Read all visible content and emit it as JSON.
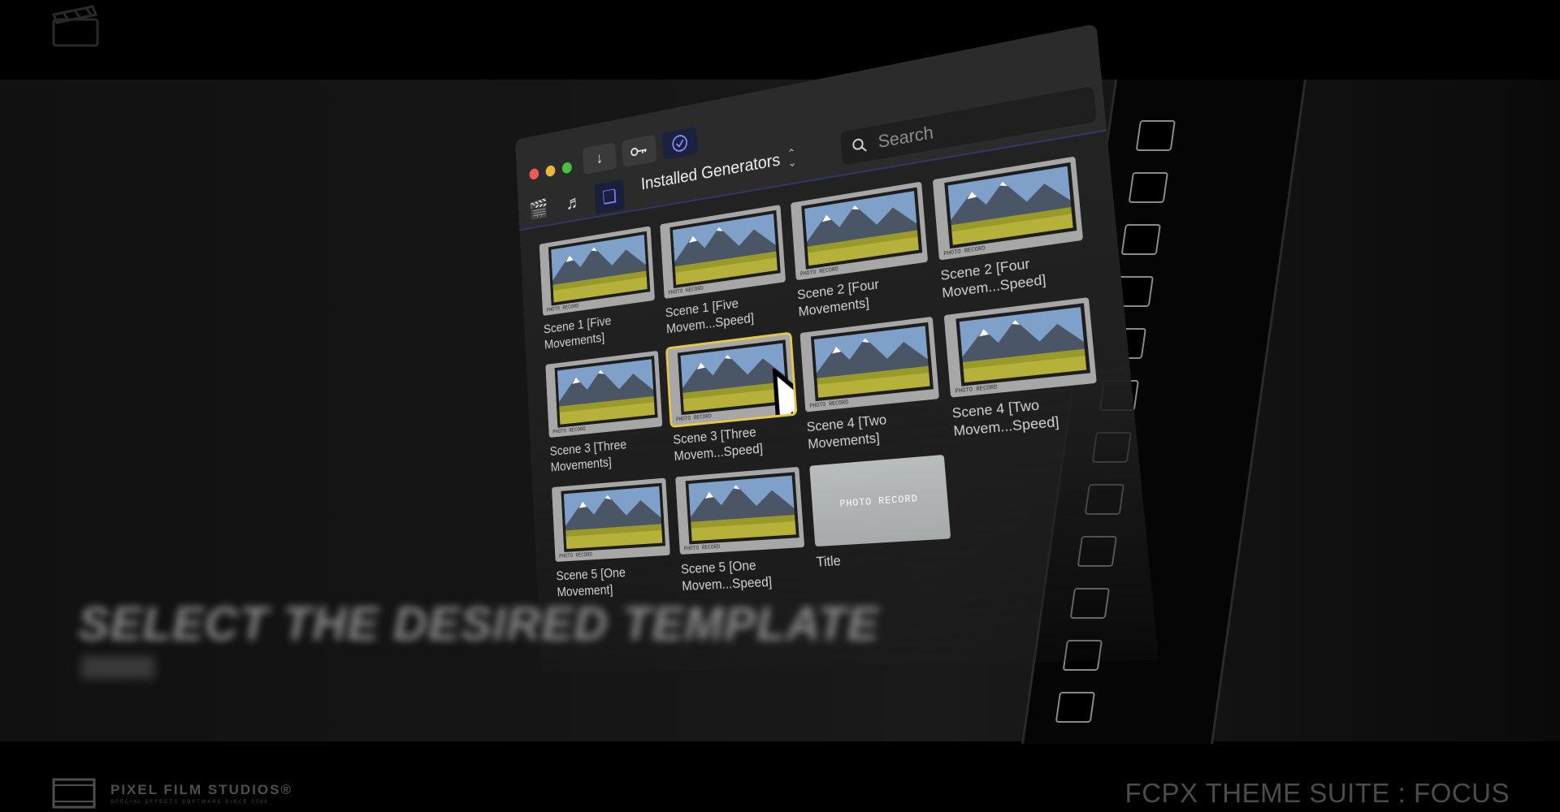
{
  "toolbar": {
    "download_icon": "down-arrow-icon",
    "key_icon": "key-icon",
    "check_icon": "checkmark-circle-icon"
  },
  "tabs": {
    "items": [
      {
        "icon": "clapperboard-star-icon"
      },
      {
        "icon": "camera-music-icon"
      },
      {
        "icon": "generator-icon",
        "active": true
      }
    ]
  },
  "library": {
    "dropdown_label": "Installed Generators"
  },
  "search": {
    "placeholder": "Search",
    "value": ""
  },
  "generators": [
    {
      "label": "Scene 1 [Five Movements]",
      "selected": false
    },
    {
      "label": "Scene 1 [Five Movem...Speed]",
      "selected": false
    },
    {
      "label": "Scene 2 [Four Movements]",
      "selected": false
    },
    {
      "label": "Scene 2 [Four Movem...Speed]",
      "selected": false
    },
    {
      "label": "Scene 3 [Three Movements]",
      "selected": false
    },
    {
      "label": "Scene 3 [Three Movem...Speed]",
      "selected": true
    },
    {
      "label": "Scene 4 [Two Movements]",
      "selected": false
    },
    {
      "label": "Scene 4 [Two Movem...Speed]",
      "selected": false
    },
    {
      "label": "Scene 5 [One Movement]",
      "selected": false
    },
    {
      "label": "Scene 5 [One Movem...Speed]",
      "selected": false
    },
    {
      "label": "Title",
      "selected": false,
      "card_text": "PHOTO RECORD"
    }
  ],
  "thumb_overlay_text": "PHOTO RECORD",
  "overlay": {
    "caption": "SELECT THE DESIRED TEMPLATE"
  },
  "branding": {
    "studio": "PIXEL FILM STUDIOS",
    "studio_mark": "®",
    "tagline": "SPECIAL EFFECTS SOFTWARE SINCE 2008",
    "product_title": "FCPX THEME SUITE : FOCUS"
  },
  "colors": {
    "selection": "#e7c74a",
    "accent": "#7f7bff",
    "close": "#ee5b52",
    "minimize": "#e9b63b",
    "zoom": "#4bbf45"
  }
}
